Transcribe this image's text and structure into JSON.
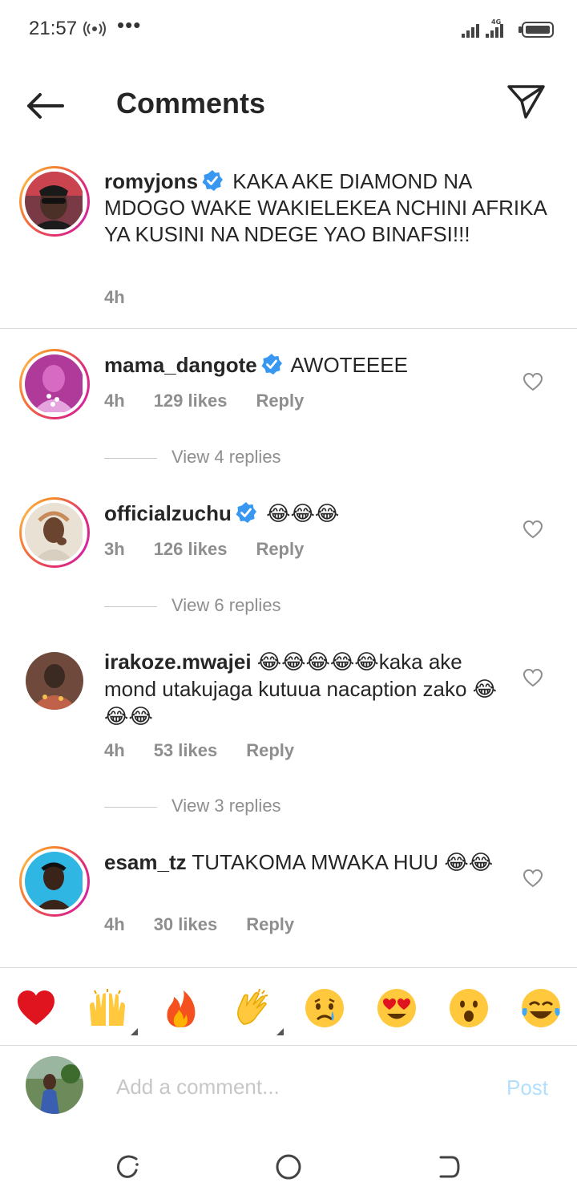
{
  "status_bar": {
    "time": "21:57",
    "dots": "•••",
    "network": "4G"
  },
  "header": {
    "title": "Comments"
  },
  "caption": {
    "username": "romyjons",
    "text": "KAKA AKE DIAMOND NA MDOGO WAKE WAKIELEKEA NCHINI AFRIKA YA KUSINI NA NDEGE YAO BINAFSI!!!",
    "time": "4h"
  },
  "comments": [
    {
      "username": "mama_dangote",
      "text": "AWOTEEEE",
      "time": "4h",
      "likes": "129 likes",
      "reply": "Reply",
      "view_replies": "View 4 replies"
    },
    {
      "username": "officialzuchu",
      "text": "😂😂😂",
      "time": "3h",
      "likes": "126 likes",
      "reply": "Reply",
      "view_replies": "View 6 replies"
    },
    {
      "username": "irakoze.mwajei",
      "text_a": "😂😂😂😂😂",
      "text_b": "kaka ake mond utakujaga kutuua nacaption zako ",
      "text_c": "😂😂😂",
      "time": "4h",
      "likes": "53 likes",
      "reply": "Reply",
      "view_replies": "View 3 replies"
    },
    {
      "username": "esam_tz",
      "text_a": "TUTAKOMA MWAKA HUU ",
      "text_b": "😂😂",
      "time": "4h",
      "likes": "30 likes",
      "reply": "Reply"
    }
  ],
  "reactions": [
    "❤️",
    "🙌",
    "🔥",
    "👏",
    "😢",
    "😍",
    "😮",
    "😂"
  ],
  "composer": {
    "placeholder": "Add a comment...",
    "post_label": "Post"
  },
  "colors": {
    "accent": "#0095f6",
    "post_disabled": "#b2dffc",
    "muted": "#8e8e8e",
    "text": "#262626"
  }
}
